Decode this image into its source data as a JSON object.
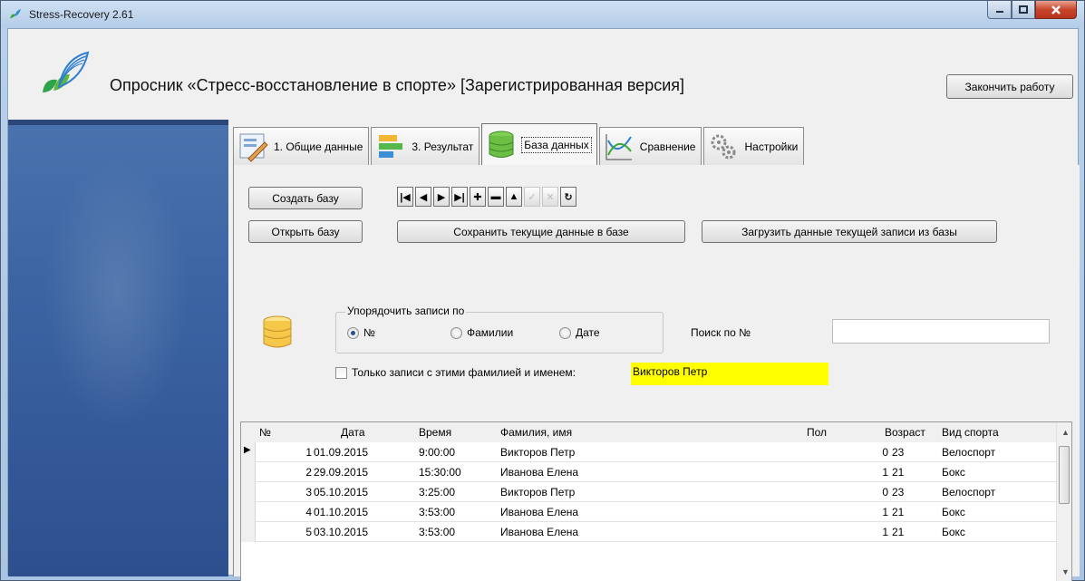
{
  "window": {
    "title": "Stress-Recovery 2.61"
  },
  "header": {
    "heading": "Опросник «Стресс-восстановление в спорте» [Зарегистрированная версия]",
    "finish_button": "Закончить работу"
  },
  "tabs": [
    {
      "label": "1. Общие данные",
      "icon": "form-edit-icon",
      "active": false
    },
    {
      "label": "3. Результат",
      "icon": "bar-chart-icon",
      "active": false
    },
    {
      "label": "База данных",
      "icon": "database-icon",
      "active": true
    },
    {
      "label": "Сравнение",
      "icon": "line-chart-icon",
      "active": false
    },
    {
      "label": "Настройки",
      "icon": "gears-icon",
      "active": false
    }
  ],
  "db": {
    "create_button": "Создать базу",
    "open_button": "Открыть базу",
    "save_button": "Сохранить текущие данные в базе",
    "load_button": "Загрузить данные текущей записи из базы",
    "nav": [
      "first",
      "prior",
      "next",
      "last",
      "insert",
      "delete",
      "edit",
      "post",
      "cancel",
      "refresh"
    ],
    "sort": {
      "legend": "Упорядочить записи по",
      "options": [
        "№",
        "Фамилии",
        "Дате"
      ],
      "selected": "№"
    },
    "search": {
      "label": "Поиск по №",
      "value": ""
    },
    "only_filter": {
      "label": "Только записи с этими фамилией и именем:",
      "checked": false,
      "name": "Викторов Петр"
    }
  },
  "grid": {
    "columns": [
      "№",
      "Дата",
      "Время",
      "Фамилия, имя",
      "Пол",
      "Возраст",
      "Вид спорта"
    ],
    "rows": [
      [
        "1",
        "01.09.2015",
        "9:00:00",
        "Викторов Петр",
        "0",
        "23",
        "Велоспорт"
      ],
      [
        "2",
        "29.09.2015",
        "15:30:00",
        "Иванова Елена",
        "1",
        "21",
        "Бокс"
      ],
      [
        "3",
        "05.10.2015",
        "3:25:00",
        "Викторов Петр",
        "0",
        "23",
        "Велоспорт"
      ],
      [
        "4",
        "01.10.2015",
        "3:53:00",
        "Иванова Елена",
        "1",
        "21",
        "Бокс"
      ],
      [
        "5",
        "03.10.2015",
        "3:53:00",
        "Иванова Елена",
        "1",
        "21",
        "Бокс"
      ]
    ],
    "current_row": 0
  }
}
